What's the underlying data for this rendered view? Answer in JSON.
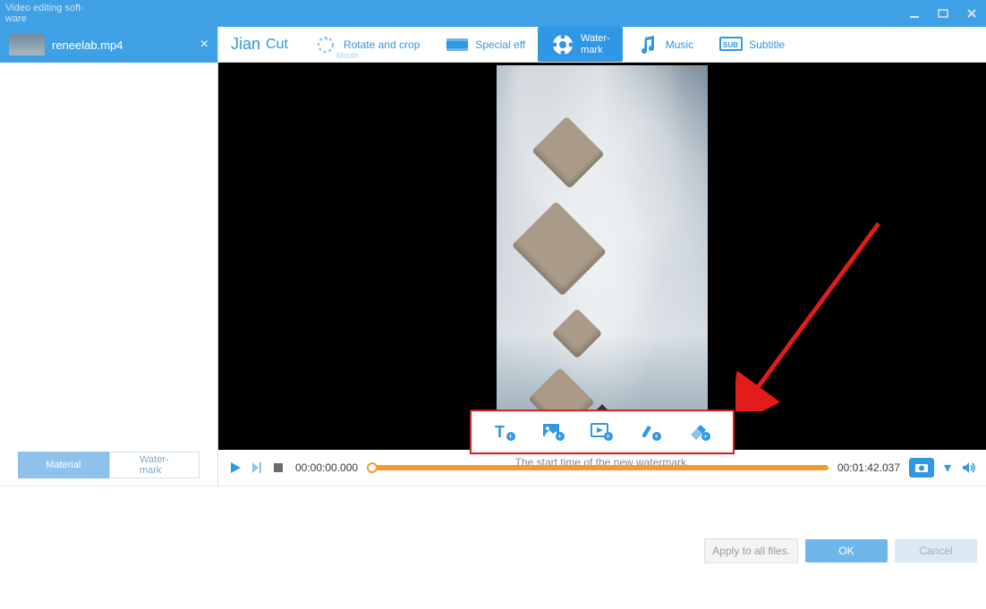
{
  "app_title": "Video editing soft-\nware",
  "file": {
    "name": "reneelab.mp4"
  },
  "toolbar": {
    "jian": "Jian",
    "cut": "Cut",
    "mouth": "Mouth",
    "rotate": "Rotate and crop",
    "special": "Special eff",
    "watermark": "Water-\nmark",
    "music": "Music",
    "subtitle": "Subtitle"
  },
  "sidebar_tabs": {
    "material": "Material",
    "watermark": "Water-\nmark"
  },
  "time": {
    "start": "00:00:00.000",
    "end": "00:01:42.037"
  },
  "wm_hint": "The start time of the new watermark.",
  "footer": {
    "apply": "Apply to all files.",
    "ok": "OK",
    "cancel": "Cancel"
  },
  "placeholder": " "
}
